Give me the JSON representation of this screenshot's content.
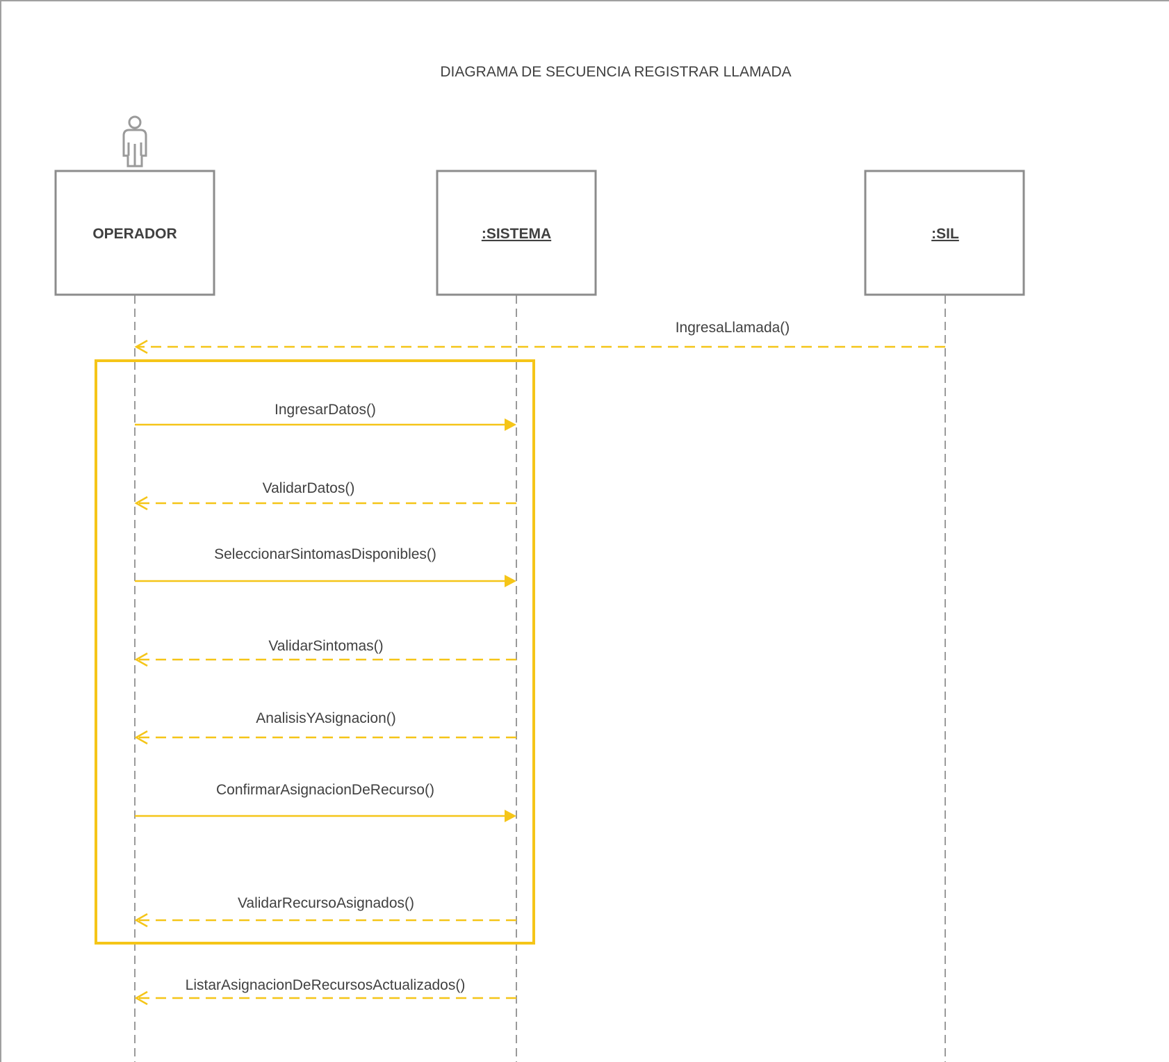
{
  "diagram": {
    "title": "DIAGRAMA DE SECUENCIA REGISTRAR LLAMADA",
    "colors": {
      "message": "#F5C518",
      "lifeline": "#9a9a9a",
      "box_border": "#8c8c8c",
      "text": "#404040",
      "frame_border": "#a0a0a0"
    },
    "participants": [
      {
        "id": "operador",
        "name": "OPERADOR",
        "underline": false,
        "icon": "actor-icon"
      },
      {
        "id": "sistema",
        "name": ":SISTEMA",
        "underline": true
      },
      {
        "id": "sil",
        "name": ":SIL",
        "underline": true
      }
    ],
    "messages": [
      {
        "label": "IngresaLlamada()",
        "from": "sil",
        "to": "operador",
        "style": "dashed"
      },
      {
        "label": "IngresarDatos()",
        "from": "operador",
        "to": "sistema",
        "style": "solid"
      },
      {
        "label": "ValidarDatos()",
        "from": "sistema",
        "to": "operador",
        "style": "dashed"
      },
      {
        "label": "SeleccionarSintomasDisponibles()",
        "from": "operador",
        "to": "sistema",
        "style": "solid"
      },
      {
        "label": "ValidarSintomas()",
        "from": "sistema",
        "to": "operador",
        "style": "dashed"
      },
      {
        "label": "AnalisisYAsignacion()",
        "from": "sistema",
        "to": "operador",
        "style": "dashed"
      },
      {
        "label": "ConfirmarAsignacionDeRecurso()",
        "from": "operador",
        "to": "sistema",
        "style": "solid"
      },
      {
        "label": "ValidarRecursoAsignados()",
        "from": "sistema",
        "to": "operador",
        "style": "dashed"
      },
      {
        "label": "ListarAsignacionDeRecursosActualizados()",
        "from": "sistema",
        "to": "operador",
        "style": "dashed"
      }
    ]
  }
}
